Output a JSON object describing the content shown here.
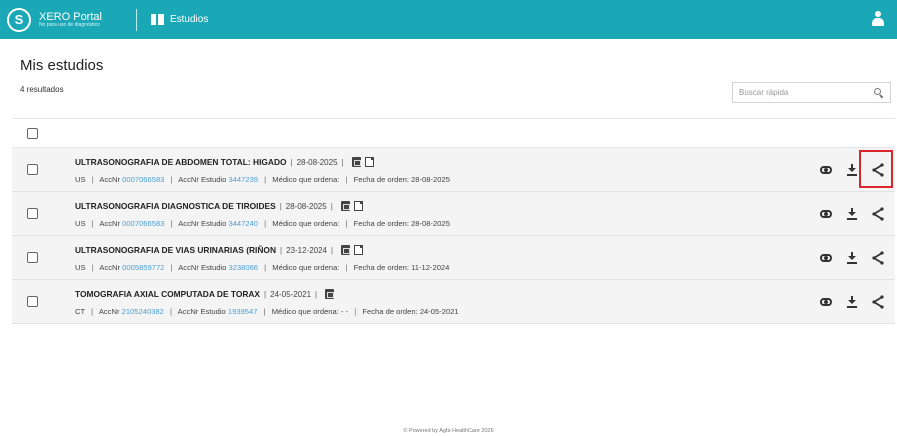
{
  "header": {
    "brand_title": "XERO Portal",
    "brand_subtitle": "No para uso de diagnóstico",
    "nav_label": "Estudios",
    "accent_color": "#1aa8b6"
  },
  "page": {
    "title": "Mis estudios",
    "results_count": "4 resultados",
    "search_placeholder": "Buscar rápida"
  },
  "studies": [
    {
      "title": "ULTRASONOGRAFIA DE ABDOMEN TOTAL: HIGADO",
      "date": "28-08-2025",
      "modality": "US",
      "accnr_label": "AccNr",
      "accnr": "0007066583",
      "accnr_estudio_label": "AccNr Estudio",
      "accnr_estudio": "3447239",
      "medico_label": "Médico que ordena:",
      "medico": "",
      "fecha_orden_label": "Fecha de orden:",
      "fecha_orden": "28-08-2025"
    },
    {
      "title": "ULTRASONOGRAFIA DIAGNOSTICA DE TIROIDES",
      "date": "28-08-2025",
      "modality": "US",
      "accnr_label": "AccNr",
      "accnr": "0007066583",
      "accnr_estudio_label": "AccNr Estudio",
      "accnr_estudio": "3447240",
      "medico_label": "Médico que ordena:",
      "medico": "",
      "fecha_orden_label": "Fecha de orden:",
      "fecha_orden": "28-08-2025"
    },
    {
      "title": "ULTRASONOGRAFIA DE VIAS URINARIAS (RIÑON",
      "date": "23-12-2024",
      "modality": "US",
      "accnr_label": "AccNr",
      "accnr": "0005859772",
      "accnr_estudio_label": "AccNr Estudio",
      "accnr_estudio": "3238066",
      "medico_label": "Médico que ordena:",
      "medico": "",
      "fecha_orden_label": "Fecha de orden:",
      "fecha_orden": "11-12-2024"
    },
    {
      "title": "TOMOGRAFIA AXIAL COMPUTADA DE TORAX",
      "date": "24-05-2021",
      "modality": "CT",
      "accnr_label": "AccNr",
      "accnr": "2105240382",
      "accnr_estudio_label": "AccNr Estudio",
      "accnr_estudio": "1939547",
      "medico_label": "Médico que ordena:",
      "medico": "- -",
      "fecha_orden_label": "Fecha de orden:",
      "fecha_orden": "24-05-2021"
    }
  ],
  "footer": {
    "text": "© Powered by Agfa HealthCare 2026"
  }
}
